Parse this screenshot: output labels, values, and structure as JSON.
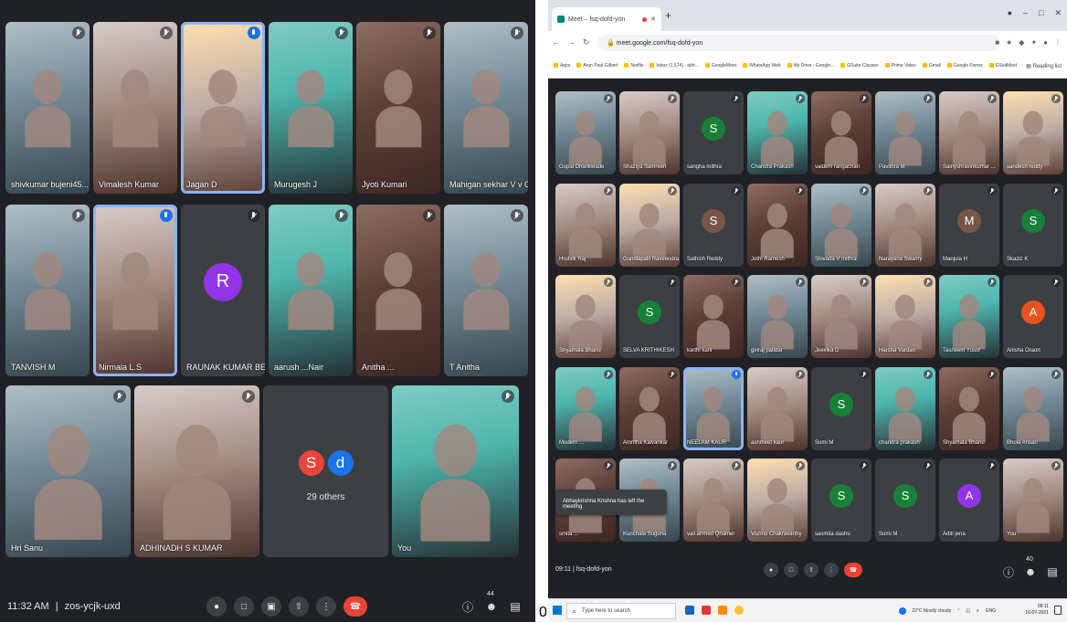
{
  "left_meet": {
    "tiles_row1": [
      {
        "name": "shivkumar bujeni45...",
        "kind": "video"
      },
      {
        "name": "Vimalesh Kumar",
        "kind": "video"
      },
      {
        "name": "Jagan D",
        "kind": "video",
        "speaking": true
      },
      {
        "name": "Murugesh J",
        "kind": "video"
      },
      {
        "name": "Jyoti Kumari",
        "kind": "video"
      },
      {
        "name": "Mahigan sekhar V v Ch...",
        "kind": "video"
      }
    ],
    "tiles_row2": [
      {
        "name": "TANVISH M",
        "kind": "video"
      },
      {
        "name": "Nirmala L.S",
        "kind": "video",
        "speaking": true
      },
      {
        "name": "RAUNAK KUMAR BEHERA",
        "kind": "avatar",
        "initial": "R",
        "color": "#9334e6"
      },
      {
        "name": "aarush ...Nair",
        "kind": "video"
      },
      {
        "name": "Anitha ...",
        "kind": "video"
      },
      {
        "name": "T Anitha",
        "kind": "video"
      }
    ],
    "tiles_row3": [
      {
        "name": "Hri Sanu",
        "kind": "video"
      },
      {
        "name": "ADHINADH S KUMAR",
        "kind": "video"
      },
      {
        "name": "29 others",
        "kind": "others"
      },
      {
        "name": "You",
        "kind": "video"
      }
    ],
    "others_bubbles": [
      {
        "initial": "S",
        "color": "#e8453c"
      },
      {
        "initial": "d",
        "color": "#1a73e8"
      }
    ],
    "time": "11:32 AM",
    "meeting_code": "zos-ycjk-uxd",
    "participant_count": "44",
    "stray_char": "0"
  },
  "browser": {
    "tab_title": "Meet – fsq-dofd-yon",
    "new_tab": "+",
    "url": "meet.google.com/fsq-dofd-yon",
    "bookmarks": [
      "Apps",
      "Arun Paul Gilbert",
      "Netflix",
      "Inbox (1,574) - abh...",
      "GoogleMeet",
      "WhatsApp Web",
      "My Drive - Google...",
      "GSuite Classes",
      "Prime Video",
      "Gmail",
      "Google Forms",
      "GSuitMeet"
    ],
    "reading_list": "Reading list"
  },
  "right_meet": {
    "rows": [
      [
        {
          "name": "Gopal Dhankwade",
          "kind": "video"
        },
        {
          "name": "Shaziya Samreen",
          "kind": "video"
        },
        {
          "name": "sangha mithra",
          "kind": "avatar",
          "initial": "S",
          "color": "#188038"
        },
        {
          "name": "Chandra Prakash",
          "kind": "video"
        },
        {
          "name": "vaidehi rangachari",
          "kind": "video"
        },
        {
          "name": "Pavithra M",
          "kind": "video"
        },
        {
          "name": "Sainyshravinkumar ...",
          "kind": "video"
        },
        {
          "name": "sandesh reddy",
          "kind": "video"
        }
      ],
      [
        {
          "name": "Hrutvik Raj",
          "kind": "video"
        },
        {
          "name": "Gundlapalli Raveendra",
          "kind": "video"
        },
        {
          "name": "Sathish Reddy",
          "kind": "avatar",
          "initial": "S",
          "color": "#795548"
        },
        {
          "name": "Jothi Ramesh",
          "kind": "video"
        },
        {
          "name": "Shivada V mithra",
          "kind": "video"
        },
        {
          "name": "Narayana Swamy",
          "kind": "video"
        },
        {
          "name": "Manjula H",
          "kind": "avatar",
          "initial": "M",
          "color": "#795548"
        },
        {
          "name": "Skaziz K",
          "kind": "avatar",
          "initial": "S",
          "color": "#188038"
        }
      ],
      [
        {
          "name": "Shyamala Bhanu",
          "kind": "video"
        },
        {
          "name": "SELVA KRITHIKESH",
          "kind": "avatar",
          "initial": "S",
          "color": "#188038"
        },
        {
          "name": "karthi kani",
          "kind": "video"
        },
        {
          "name": "giriraj patidar",
          "kind": "video"
        },
        {
          "name": "Jeevika D",
          "kind": "video"
        },
        {
          "name": "Harsha Vardan",
          "kind": "video"
        },
        {
          "name": "Tasneem Yusuf",
          "kind": "video"
        },
        {
          "name": "Anisha Oraon",
          "kind": "avatar",
          "initial": "A",
          "color": "#e8541c"
        }
      ],
      [
        {
          "name": "Modern ...",
          "kind": "video"
        },
        {
          "name": "Amritha Kalvankar",
          "kind": "video"
        },
        {
          "name": "NEELAM KAUR",
          "kind": "video",
          "speaking": true
        },
        {
          "name": "ashmeet kaur",
          "kind": "video"
        },
        {
          "name": "Sumi M",
          "kind": "avatar",
          "initial": "S",
          "color": "#188038"
        },
        {
          "name": "chandra prakash",
          "kind": "video"
        },
        {
          "name": "Shyamala Bhanu",
          "kind": "video"
        },
        {
          "name": "Bhola Ansari",
          "kind": "video"
        }
      ],
      [
        {
          "name": "smita ...",
          "kind": "video"
        },
        {
          "name": "Kunchala Suguna",
          "kind": "video"
        },
        {
          "name": "vali ahmed Qhamer",
          "kind": "video"
        },
        {
          "name": "Vishnu Chakravarthy",
          "kind": "video"
        },
        {
          "name": "sasmita dashu",
          "kind": "avatar",
          "initial": "S",
          "color": "#188038"
        },
        {
          "name": "Sumi M",
          "kind": "avatar",
          "initial": "S",
          "color": "#188038"
        },
        {
          "name": "Aditi jena",
          "kind": "avatar",
          "initial": "A",
          "color": "#9334e6"
        },
        {
          "name": "You",
          "kind": "video"
        }
      ]
    ],
    "toast": "Abhaykrishna Krishna has left the meeting",
    "time": "09:11",
    "meeting_code": "fsq-dofd-yon",
    "participant_count": "40"
  },
  "taskbar": {
    "search_placeholder": "Type here to search",
    "weather": "22°C Mostly cloudy",
    "lang": "ENG",
    "time": "09:11",
    "date": "16-07-2021"
  }
}
